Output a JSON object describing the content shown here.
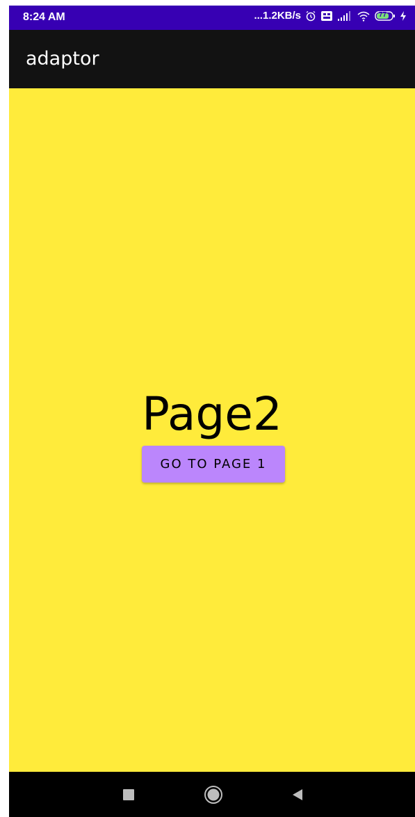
{
  "status_bar": {
    "time": "8:24 AM",
    "network_speed": "...1.2KB/s",
    "icons": [
      "alarm-icon",
      "volte-icon",
      "signal-icon",
      "wifi-icon",
      "battery-icon",
      "charging-icon"
    ],
    "battery_level": "77",
    "background": "#3700b3"
  },
  "app_bar": {
    "title": "adaptor",
    "background": "#121212"
  },
  "content": {
    "heading": "Page2",
    "button_label": "GO TO PAGE 1",
    "background": "#ffeb3b",
    "button_color": "#bb86fc"
  },
  "nav_bar": {
    "icons": [
      "recents-icon",
      "home-icon",
      "back-icon"
    ]
  }
}
